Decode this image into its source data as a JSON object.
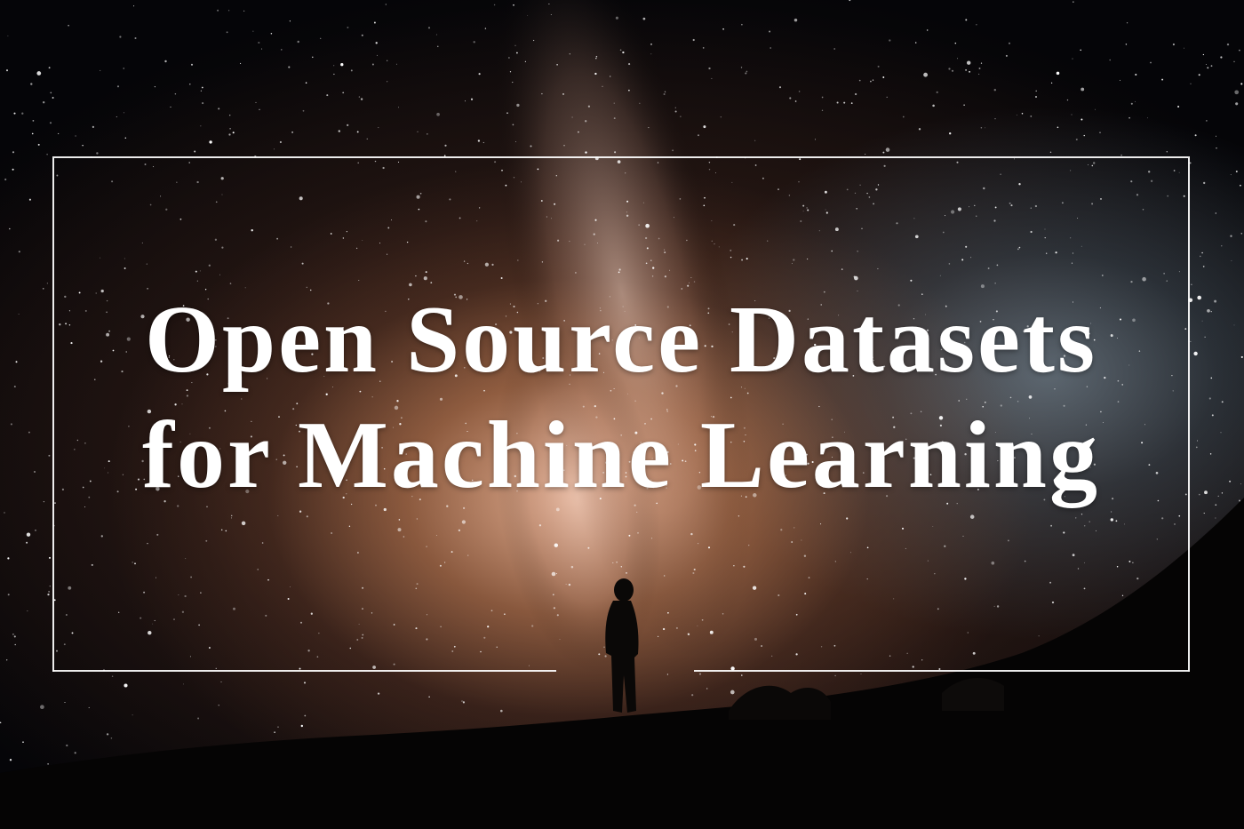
{
  "title": {
    "line1": "Open Source Datasets",
    "line2": "for Machine Learning"
  },
  "colors": {
    "text": "#ffffff",
    "frame": "#ffffff",
    "sky_glow": "#f5bea0",
    "sky_blue": "#8caabe",
    "background": "#000000"
  }
}
